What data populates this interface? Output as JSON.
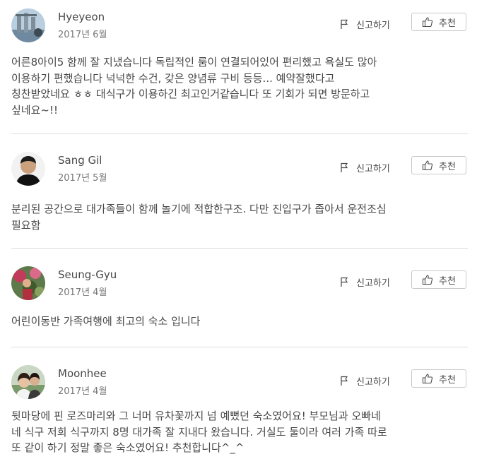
{
  "reviews": [
    {
      "name": "Hyeyeon",
      "date": "2017년 6월",
      "report_label": "신고하기",
      "recommend_label": "추천",
      "lines": [
        "어른8아이5 함께 잘 지냈습니다 독립적인 룸이 연결되어있어 편리했고 욕실도 많아",
        "이용하기 편했습니다 넉넉한 수건, 갖은 양념류 구비 등등... 예약잘했다고",
        "칭찬받았네요 ㅎㅎ 대식구가 이용하긴 최고인거같습니다 또 기회가 되면 방문하고",
        "싶네요~!!"
      ]
    },
    {
      "name": "Sang Gil",
      "date": "2017년 5월",
      "report_label": "신고하기",
      "recommend_label": "추천",
      "lines": [
        "분리된 공간으로 대가족들이 함께 놀기에 적합한구조. 다만 진입구가 좁아서 운전조심",
        "필요함"
      ]
    },
    {
      "name": "Seung-Gyu",
      "date": "2017년 4월",
      "report_label": "신고하기",
      "recommend_label": "추천",
      "lines": [
        "어린이동반 가족여행에 최고의 숙소 입니다"
      ]
    },
    {
      "name": "Moonhee",
      "date": "2017년 4월",
      "report_label": "신고하기",
      "recommend_label": "추천",
      "lines": [
        "뒷마당에 핀 로즈마리와 그 너머 유차꽃까지 넘 예뻤던 숙소였어요! 부모님과 오빠네",
        "네 식구 저희 식구까지 8명 대가족 잘 지내다 왔습니다. 거실도 둘이라 여러 가족 따로",
        "또 같이 하기 정말 좋은 숙소였어요! 추천합니다^_^"
      ]
    }
  ],
  "icons": {
    "report": "flag-icon",
    "recommend": "thumbs-up-icon"
  }
}
